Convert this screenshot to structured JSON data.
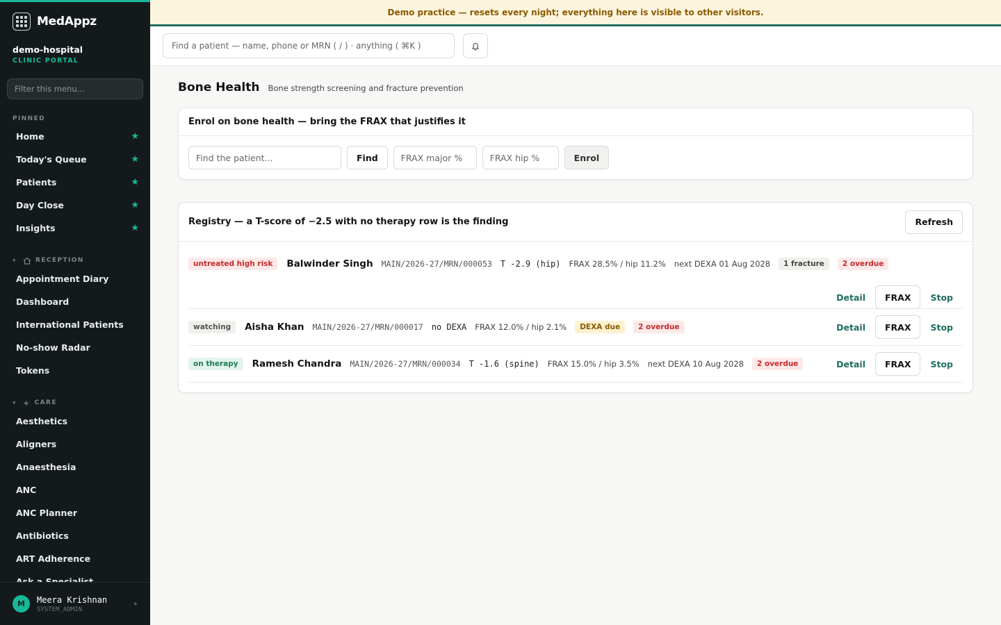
{
  "brand": {
    "name": "MedAppz"
  },
  "org": {
    "name": "demo-hospital",
    "sub": "CLINIC PORTAL"
  },
  "sidebar": {
    "filter_placeholder": "Filter this menu...",
    "pinned_label": "PINNED",
    "pinned": [
      {
        "label": "Home"
      },
      {
        "label": "Today's Queue"
      },
      {
        "label": "Patients"
      },
      {
        "label": "Day Close"
      },
      {
        "label": "Insights"
      }
    ],
    "reception_label": "RECEPTION",
    "reception": [
      {
        "label": "Appointment Diary"
      },
      {
        "label": "Dashboard"
      },
      {
        "label": "International Patients"
      },
      {
        "label": "No-show Radar"
      },
      {
        "label": "Tokens"
      }
    ],
    "care_label": "CARE",
    "care": [
      {
        "label": "Aesthetics"
      },
      {
        "label": "Aligners"
      },
      {
        "label": "Anaesthesia"
      },
      {
        "label": "ANC"
      },
      {
        "label": "ANC Planner"
      },
      {
        "label": "Antibiotics"
      },
      {
        "label": "ART Adherence"
      },
      {
        "label": "Ask a Specialist"
      }
    ]
  },
  "user": {
    "initial": "M",
    "name": "Meera Krishnan",
    "role": "SYSTEM_ADMIN"
  },
  "banner": {
    "text": "Demo practice — resets every night; everything here is visible to other visitors."
  },
  "topbar": {
    "search_placeholder": "Find a patient — name, phone or MRN ( / ) · anything ( ⌘K )"
  },
  "page": {
    "title": "Bone Health",
    "subtitle": "Bone strength screening and fracture prevention"
  },
  "enrol": {
    "heading": "Enrol on bone health — bring the FRAX that justifies it",
    "patient_placeholder": "Find the patient...",
    "find_label": "Find",
    "frax_major_placeholder": "FRAX major %",
    "frax_hip_placeholder": "FRAX hip %",
    "enrol_label": "Enrol"
  },
  "registry": {
    "heading": "Registry — a T-score of −2.5 with no therapy row is the finding",
    "refresh_label": "Refresh",
    "detail_label": "Detail",
    "frax_label": "FRAX",
    "stop_label": "Stop",
    "rows": [
      {
        "status": "untreated high risk",
        "name": "Balwinder Singh",
        "mrn": "MAIN/2026-27/MRN/000053",
        "tscore": "T -2.9 (hip)",
        "frax": "FRAX 28.5% / hip 11.2%",
        "next": "next DEXA 01 Aug 2028",
        "fracture": "1 fracture",
        "overdue": "2 overdue"
      },
      {
        "status": "watching",
        "name": "Aisha Khan",
        "mrn": "MAIN/2026-27/MRN/000017",
        "tscore": "no DEXA",
        "frax": "FRAX 12.0% / hip 2.1%",
        "dexa": "DEXA due",
        "overdue": "2 overdue"
      },
      {
        "status": "on therapy",
        "name": "Ramesh Chandra",
        "mrn": "MAIN/2026-27/MRN/000034",
        "tscore": "T -1.6 (spine)",
        "frax": "FRAX 15.0% / hip 3.5%",
        "next": "next DEXA 10 Aug 2028",
        "overdue": "2 overdue"
      }
    ]
  }
}
